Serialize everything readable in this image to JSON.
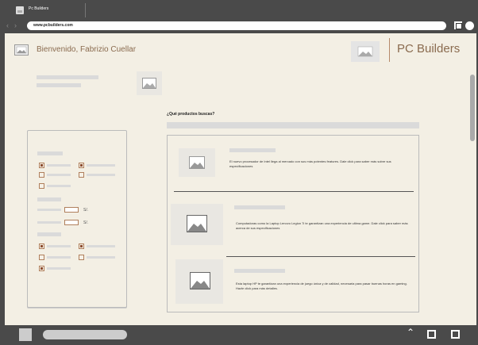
{
  "tab": {
    "title": "Pc Builders"
  },
  "browser": {
    "url": "www.pcbuilders.com"
  },
  "header": {
    "welcome": "Bienvenido, Fabrizio Cuellar",
    "brand": "PC Builders"
  },
  "search": {
    "label": "¿Qué productos buscas?"
  },
  "filters": {
    "currency_symbols": [
      "S/.",
      "S/."
    ]
  },
  "products": [
    {
      "description": "El nuevo procesador de Intel llega al mercado con sus más potentes features. Dale click para saber más sobre sus especificaciones"
    },
    {
      "description": "Computadoras como la Laptop Lenovo Legion 7i te garantizan una experiencia de ultima game. Dale click para saber más acerca de sus especificaciones"
    },
    {
      "description": "Esta laptop HP te garantizan una experiencia de juego única y de calidad, necesaria para pasar buenas horas en gaming. Hazle click para más detalles."
    }
  ],
  "icons": {
    "tab_favicon": "image-icon",
    "back": "chevron-left-icon",
    "forward": "chevron-right-icon",
    "window_square": "square-icon",
    "window_circle": "circle-icon",
    "bottom_chevron": "chevron-up-icon",
    "cursor": "mouse-pointer-icon"
  },
  "colors": {
    "background": "#f3efe4",
    "accent": "#8a6b4f",
    "checkbox_border": "#b07f5c",
    "checkbox_fill": "#8b4c2e"
  }
}
